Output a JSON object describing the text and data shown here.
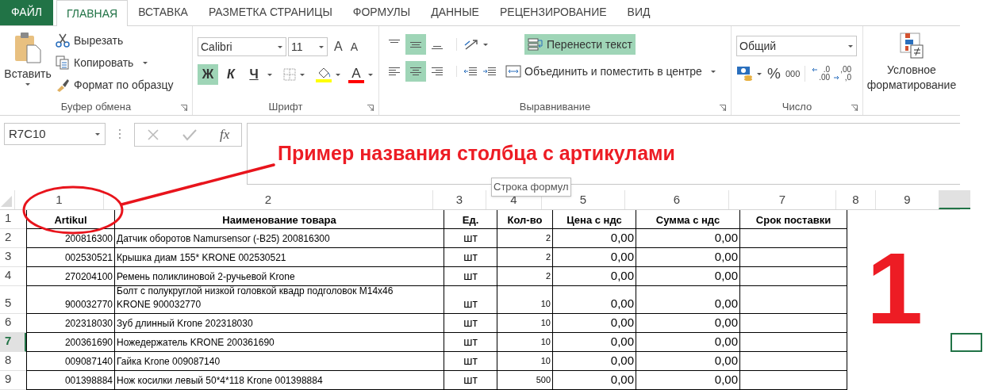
{
  "tabs": [
    {
      "label": "ФАЙЛ",
      "kind": "file",
      "selected": false
    },
    {
      "label": "ГЛАВНАЯ",
      "kind": "tab",
      "selected": true
    },
    {
      "label": "ВСТАВКА",
      "kind": "tab",
      "selected": false
    },
    {
      "label": "РАЗМЕТКА СТРАНИЦЫ",
      "kind": "tab",
      "selected": false
    },
    {
      "label": "ФОРМУЛЫ",
      "kind": "tab",
      "selected": false
    },
    {
      "label": "ДАННЫЕ",
      "kind": "tab",
      "selected": false
    },
    {
      "label": "РЕЦЕНЗИРОВАНИЕ",
      "kind": "tab",
      "selected": false
    },
    {
      "label": "ВИД",
      "kind": "tab",
      "selected": false
    }
  ],
  "clipboard": {
    "paste": "Вставить",
    "cut": "Вырезать",
    "copy": "Копировать",
    "format_painter": "Формат по образцу",
    "group_label": "Буфер обмена"
  },
  "font": {
    "name": "Calibri",
    "size": "11",
    "grow": "A",
    "shrink": "A",
    "font_color_label": "A",
    "group_label": "Шрифт",
    "styles": [
      {
        "label": "Ж",
        "kind": "bold",
        "on": true
      },
      {
        "label": "К",
        "kind": "italic",
        "on": false
      },
      {
        "label": "Ч",
        "kind": "underline",
        "on": false
      }
    ]
  },
  "alignment": {
    "vertical": [
      {
        "selected": false
      },
      {
        "selected": true
      },
      {
        "selected": false
      }
    ],
    "horizontal": [
      {
        "selected": false
      },
      {
        "selected": true
      },
      {
        "selected": false
      }
    ],
    "wrap_text": {
      "label": "Перенести текст",
      "on": true
    },
    "merge": "Объединить и поместить в центре",
    "group_label": "Выравнивание"
  },
  "number": {
    "format": "Общий",
    "percent": "%",
    "thousands": "000",
    "increase_decimal": [
      ".0",
      ".00"
    ],
    "decrease_decimal": [
      ",00",
      ",0"
    ],
    "group_label": "Число"
  },
  "styles": {
    "conditional_formatting": [
      "Условное",
      "форматирование"
    ]
  },
  "formula_bar": {
    "name_box": "R7C10",
    "fx": "fx"
  },
  "tooltip": "Строка формул",
  "annotations": {
    "callout": "Пример названия столбца с артикулами",
    "marker": "1"
  },
  "sheet": {
    "columns": [
      {
        "label": "1",
        "selected": false
      },
      {
        "label": "2",
        "selected": false
      },
      {
        "label": "3",
        "selected": false
      },
      {
        "label": "4",
        "selected": false
      },
      {
        "label": "5",
        "selected": false
      },
      {
        "label": "6",
        "selected": false
      },
      {
        "label": "7",
        "selected": false
      },
      {
        "label": "8",
        "selected": false
      },
      {
        "label": "9",
        "selected": false
      },
      {
        "selected": true
      }
    ],
    "rows": [
      {
        "label": "1",
        "kind": "header",
        "selected": false,
        "cells": [
          "Artikul",
          "Наименование товара",
          "Ед.",
          "Кол-во",
          "Цена с ндс",
          "Сумма с ндс",
          "Срок поставки"
        ]
      },
      {
        "label": "2",
        "kind": "item",
        "selected": false,
        "cells": [
          "200816300",
          "Датчик оборотов Namursensor (-B25) 200816300",
          "шт",
          "2",
          "0,00",
          "0,00"
        ]
      },
      {
        "label": "3",
        "kind": "item",
        "selected": false,
        "cells": [
          "002530521",
          "Крышка диам 155* KRONE 002530521",
          "шт",
          "2",
          "0,00",
          "0,00"
        ]
      },
      {
        "label": "4",
        "kind": "item",
        "selected": false,
        "cells": [
          "270204100",
          "Ремень поликлиновой 2-ручьевой Krone",
          "шт",
          "2",
          "0,00",
          "0,00"
        ]
      },
      {
        "label": "5",
        "kind": "item",
        "selected": false,
        "cells": [
          "900032770",
          "Болт с полукруглой низкой головкой квадр подголовок М14х46 KRONE 900032770",
          "шт",
          "10",
          "0,00",
          "0,00"
        ]
      },
      {
        "label": "6",
        "kind": "item",
        "selected": false,
        "cells": [
          "202318030",
          "Зуб длинный Krone 202318030",
          "шт",
          "10",
          "0,00",
          "0,00"
        ]
      },
      {
        "label": "7",
        "kind": "item",
        "selected": true,
        "cells": [
          "200361690",
          "Ножедержатель KRONE 200361690",
          "шт",
          "10",
          "0,00",
          "0,00"
        ]
      },
      {
        "label": "8",
        "kind": "item",
        "selected": false,
        "cells": [
          "009087140",
          "Гайка Krone 009087140",
          "шт",
          "10",
          "0,00",
          "0,00"
        ]
      },
      {
        "label": "9",
        "kind": "item",
        "selected": false,
        "cells": [
          "001398884",
          "Нож косилки левый 50*4*118 Krone 001398884",
          "шт",
          "500",
          "0,00",
          "0,00"
        ]
      }
    ]
  }
}
